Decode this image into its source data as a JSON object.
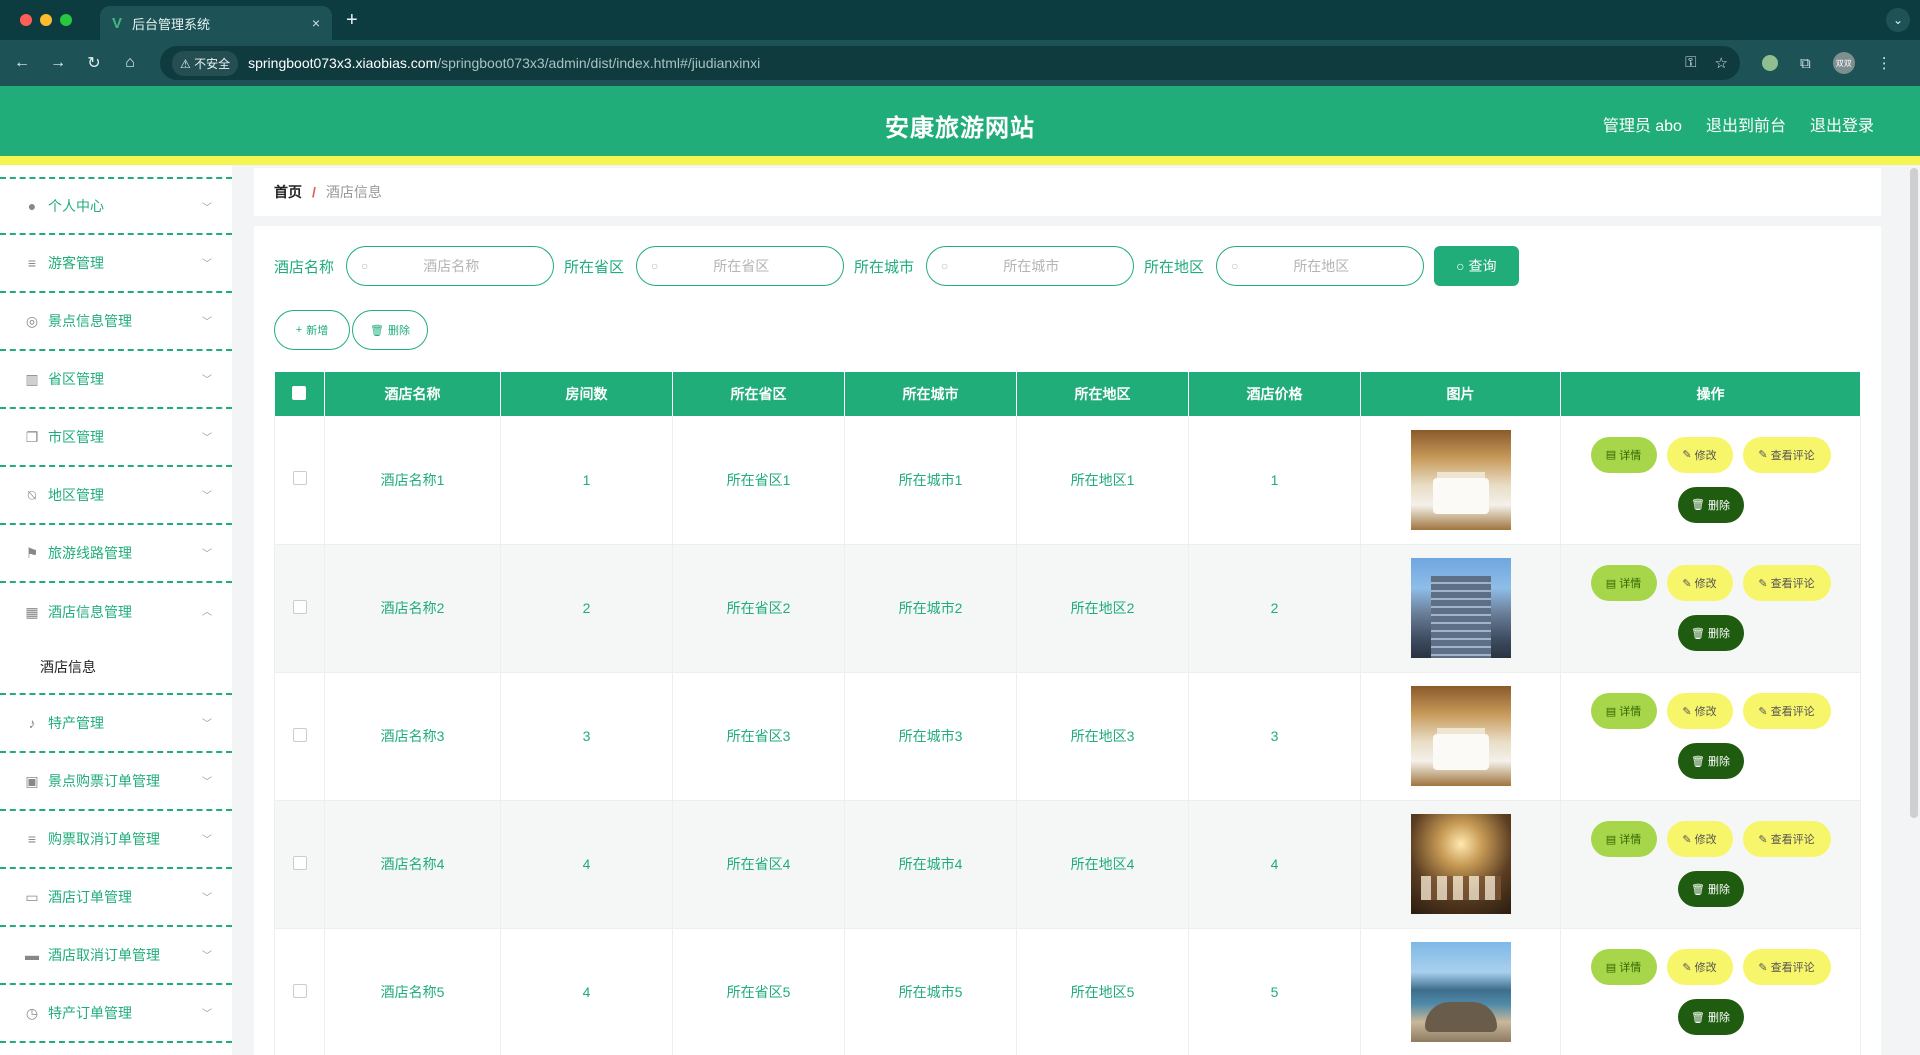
{
  "browser": {
    "tab_title": "后台管理系统",
    "tab_close": "×",
    "new_tab": "+",
    "insecure_label": "不安全",
    "url_host": "springboot073x3.xiaobias.com",
    "url_path": "/springboot073x3/admin/dist/index.html#/jiudianxinxi",
    "profile_text": "双双"
  },
  "header": {
    "site_title": "安康旅游网站",
    "user_label": "管理员 abo",
    "to_front": "退出到前台",
    "logout": "退出登录"
  },
  "sidebar": {
    "items": [
      {
        "label": "个人中心",
        "icon": "user-icon"
      },
      {
        "label": "游客管理",
        "icon": "list-icon"
      },
      {
        "label": "景点信息管理",
        "icon": "compass-icon"
      },
      {
        "label": "省区管理",
        "icon": "chart-icon"
      },
      {
        "label": "市区管理",
        "icon": "copy-icon"
      },
      {
        "label": "地区管理",
        "icon": "bell-off-icon"
      },
      {
        "label": "旅游线路管理",
        "icon": "flag-icon"
      },
      {
        "label": "酒店信息管理",
        "icon": "grid-icon"
      },
      {
        "label": "特产管理",
        "icon": "mic-icon"
      },
      {
        "label": "景点购票订单管理",
        "icon": "clipboard-icon"
      },
      {
        "label": "购票取消订单管理",
        "icon": "list-icon"
      },
      {
        "label": "酒店订单管理",
        "icon": "monitor-icon"
      },
      {
        "label": "酒店取消订单管理",
        "icon": "printer-icon"
      },
      {
        "label": "特产订单管理",
        "icon": "clock-icon"
      }
    ],
    "submenu_label": "酒店信息"
  },
  "breadcrumb": {
    "home": "首页",
    "separator": "/",
    "current": "酒店信息"
  },
  "search": {
    "name_label": "酒店名称",
    "name_placeholder": "酒店名称",
    "province_label": "所在省区",
    "province_placeholder": "所在省区",
    "city_label": "所在城市",
    "city_placeholder": "所在城市",
    "district_label": "所在地区",
    "district_placeholder": "所在地区",
    "query_label": "查询"
  },
  "actions": {
    "add_label": "新增",
    "delete_label": "删除"
  },
  "table": {
    "headers": [
      "酒店名称",
      "房间数",
      "所在省区",
      "所在城市",
      "所在地区",
      "酒店价格",
      "图片",
      "操作"
    ],
    "rows": [
      {
        "name": "酒店名称1",
        "rooms": "1",
        "province": "所在省区1",
        "city": "所在城市1",
        "district": "所在地区1",
        "price": "1",
        "photo": "bedroom"
      },
      {
        "name": "酒店名称2",
        "rooms": "2",
        "province": "所在省区2",
        "city": "所在城市2",
        "district": "所在地区2",
        "price": "2",
        "photo": "tower"
      },
      {
        "name": "酒店名称3",
        "rooms": "3",
        "province": "所在省区3",
        "city": "所在城市3",
        "district": "所在地区3",
        "price": "3",
        "photo": "bedroom"
      },
      {
        "name": "酒店名称4",
        "rooms": "4",
        "province": "所在省区4",
        "city": "所在城市4",
        "district": "所在地区4",
        "price": "4",
        "photo": "ballroom"
      },
      {
        "name": "酒店名称5",
        "rooms": "4",
        "province": "所在省区5",
        "city": "所在城市5",
        "district": "所在地区5",
        "price": "5",
        "photo": "resort"
      }
    ],
    "ops": {
      "detail": "详情",
      "edit": "修改",
      "review": "查看评论",
      "delete": "删除"
    }
  },
  "colors": {
    "primary": "#20ad7a",
    "accent_yellow": "#f5f552",
    "detail_green": "#a8d64a",
    "delete_dark": "#1f5c10"
  }
}
